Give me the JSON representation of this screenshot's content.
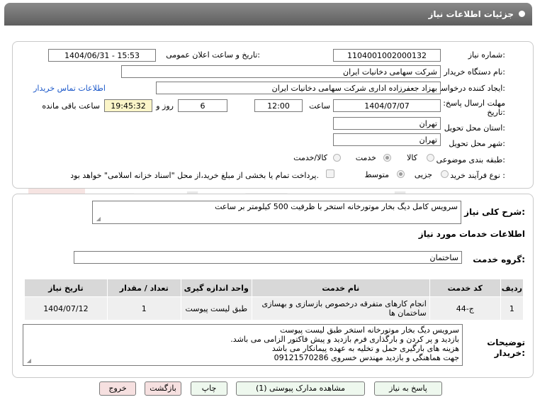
{
  "header": {
    "title": "جزئیات اطلاعات نیاز"
  },
  "form": {
    "need_number_label": "شماره نیاز:",
    "need_number": "1104001002000132",
    "announce_label": "تاریخ و ساعت اعلان عمومی:",
    "announce_value": "1404/06/31 - 15:53",
    "buyer_label": "نام دستگاه خریدار:",
    "buyer_value": "شرکت سهامی دخانیات ایران",
    "creator_label": "ایجاد کننده درخواست:",
    "creator_value": "بهزاد جعفرزاده اداری شرکت سهامی دخانیات ایران",
    "contact_link": "اطلاعات تماس خریدار",
    "deadline_label_1": "مهلت ارسال پاسخ: تا",
    "deadline_label_2": "تاریخ:",
    "deadline_date": "1404/07/07",
    "time_label": "ساعت",
    "deadline_time": "12:00",
    "days_value": "6",
    "days_label": "روز و",
    "remaining_time": "19:45:32",
    "remaining_label": "ساعت باقی مانده",
    "province_label": "استان محل تحویل:",
    "province_value": "تهران",
    "city_label": "شهر محل تحویل:",
    "city_value": "تهران",
    "category_label": "طبقه بندی موضوعی:",
    "category_options": [
      "کالا",
      "خدمت",
      "کالا/خدمت"
    ],
    "process_label": "نوع فرآیند خرید :",
    "process_options": [
      "جزیی",
      "متوسط"
    ],
    "payment_note": "پرداخت تمام یا بخشی از مبلغ خرید،از محل \"اسناد خزانه اسلامی\" خواهد بود."
  },
  "summary": {
    "label": "شرح کلی نیاز:",
    "value": "سرویس کامل دیگ بخار موتورخانه استخر با ظرفیت 500 کیلومتر بر ساعت"
  },
  "services": {
    "section_title": "اطلاعات خدمات مورد نیاز",
    "group_label": "گروه خدمت:",
    "group_value": "ساختمان",
    "columns": [
      "ردیف",
      "کد خدمت",
      "نام خدمت",
      "واحد اندازه گیری",
      "تعداد / مقدار",
      "تاریخ نیاز"
    ],
    "rows": [
      {
        "row": "1",
        "code": "ج-44",
        "name": "انجام کارهای متفرقه درخصوص بازسازی و بهسازی ساختمان ها",
        "unit": "طبق لیست پیوست",
        "qty": "1",
        "date": "1404/07/12"
      }
    ]
  },
  "notes": {
    "label_1": "توضیحات",
    "label_2": "خریدار:",
    "lines": [
      "سرویس دیگ بخار موتورخانه استخر طبق لیست پیوست",
      "بازدید و پر کردن و بارگذاری فرم بازدید و پیش فاکتور الزامی می باشد.",
      "هزینه های بارگیری حمل و تخلیه به عهده پیمانکار می باشد",
      "جهت هماهنگی و بازدید مهندس خسروی 09121570286"
    ]
  },
  "buttons": {
    "reply": "پاسخ به نیاز",
    "attachments": "مشاهده مدارک پیوستی (1)",
    "print": "چاپ",
    "back": "بازگشت",
    "exit": "خروج"
  },
  "colors": {
    "header": "#6f6f6f",
    "link": "#1a57c9",
    "remaining_bg": "#fbf5c8",
    "button_green": "#eef8ee",
    "button_red": "#f6e0e0"
  }
}
